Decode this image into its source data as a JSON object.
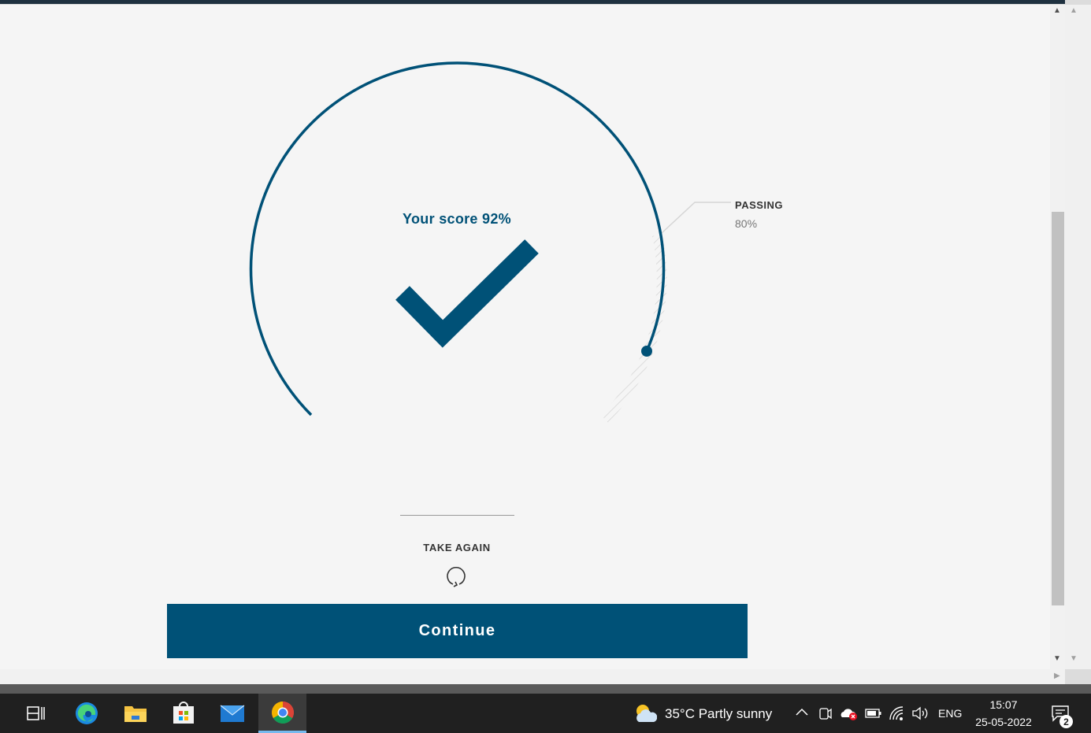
{
  "result": {
    "score_label": "Your score 92%",
    "score": 92,
    "passing_title": "PASSING",
    "passing_value": "80%",
    "passing_threshold": 80
  },
  "actions": {
    "take_again_label": "TAKE AGAIN",
    "continue_label": "Continue"
  },
  "colors": {
    "accent": "#005177",
    "background": "#f5f5f5"
  },
  "taskbar": {
    "apps": [
      "task-view-icon",
      "edge-icon",
      "file-explorer-icon",
      "store-icon",
      "mail-icon",
      "chrome-icon"
    ],
    "active_app": "chrome-icon",
    "weather": "35°C  Partly sunny",
    "language": "ENG",
    "time": "15:07",
    "date": "25-05-2022",
    "notification_count": "2"
  }
}
